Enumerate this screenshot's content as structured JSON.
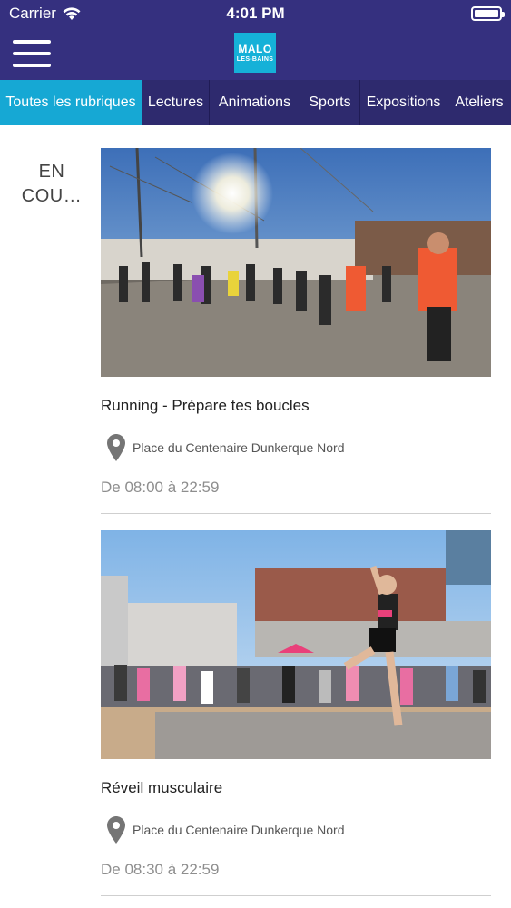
{
  "status": {
    "carrier": "Carrier",
    "time": "4:01 PM"
  },
  "app": {
    "logo_line1": "MALO",
    "logo_line2": "LES-BAINS"
  },
  "tabs": [
    {
      "label": "Toutes les rubriques",
      "active": true
    },
    {
      "label": "Lectures"
    },
    {
      "label": "Animations"
    },
    {
      "label": "Sports"
    },
    {
      "label": "Expositions"
    },
    {
      "label": "Ateliers"
    }
  ],
  "section_label": "EN COU…",
  "events": [
    {
      "title": "Running - Prépare tes boucles",
      "location": "Place du Centenaire Dunkerque Nord",
      "time": "De 08:00 à 22:59"
    },
    {
      "title": "Réveil musculaire",
      "location": "Place du Centenaire Dunkerque Nord",
      "time": "De 08:30 à 22:59"
    }
  ],
  "colors": {
    "navy": "#35307f",
    "tabbar": "#2e2a6e",
    "accent": "#16a8d4"
  }
}
